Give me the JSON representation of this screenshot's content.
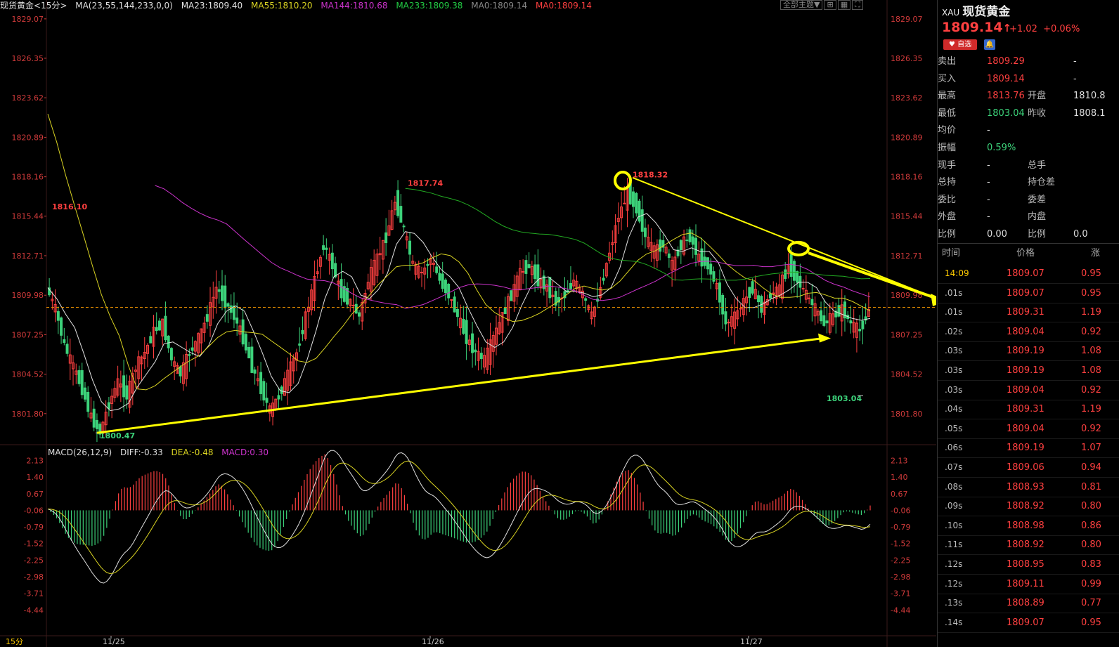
{
  "header": {
    "symbol_name": "现货黄金",
    "period": "<15分>",
    "ma_params": "MA(23,55,144,233,0,0)",
    "ma23": "MA23:1809.40",
    "ma55": "MA55:1810.20",
    "ma144": "MA144:1810.68",
    "ma233": "MA233:1809.38",
    "ma0a": "MA0:1809.14",
    "ma0b": "MA0:1809.14"
  },
  "toolbar": {
    "theme": "全部主题▼"
  },
  "macd_header": {
    "title": "MACD(26,12,9)",
    "diff": "DIFF:-0.33",
    "dea": "DEA:-0.48",
    "macd": "MACD:0.30"
  },
  "colors": {
    "up": "#ff4040",
    "down": "#3cd27a",
    "ma23": "#e0e0e0",
    "ma55": "#d9d322",
    "ma144": "#cc33cc",
    "ma233": "#22aa22",
    "annot": "#ffff00"
  },
  "price_axis": [
    "1829.07",
    "1826.35",
    "1823.62",
    "1820.89",
    "1818.16",
    "1815.44",
    "1812.71",
    "1809.98",
    "1807.25",
    "1804.52",
    "1801.80"
  ],
  "macd_axis": [
    "2.13",
    "1.40",
    "0.67",
    "-0.06",
    "-0.79",
    "-1.52",
    "-2.25",
    "-2.98",
    "-3.71",
    "-4.44"
  ],
  "labels": {
    "hi1": "1816.10",
    "hi2": "1817.74",
    "hi3": "1818.32",
    "lo1": "1800.47",
    "lo2": "1803.04"
  },
  "date_axis": [
    "11/25",
    "11/26",
    "11/27"
  ],
  "period_button": "15分",
  "panel": {
    "code": "XAU",
    "name": "现货黄金",
    "price": "1809.14",
    "arrow": "↑",
    "change": "+1.02",
    "change_pct": "+0.06%",
    "fav_label": "自选",
    "quotes": [
      {
        "l1": "卖出",
        "v1": "1809.29",
        "l2": "",
        "v2": "-"
      },
      {
        "l1": "买入",
        "v1": "1809.14",
        "l2": "",
        "v2": "-"
      },
      {
        "l1": "最高",
        "v1": "1813.76",
        "l2": "开盘",
        "v2": "1810.8"
      },
      {
        "l1": "最低",
        "v1": "1803.04",
        "l2": "昨收",
        "v2": "1808.1"
      },
      {
        "l1": "均价",
        "v1": "-",
        "l2": "",
        "v2": ""
      },
      {
        "l1": "振幅",
        "v1": "0.59%",
        "l2": "",
        "v2": ""
      },
      {
        "l1": "现手",
        "v1": "-",
        "l2": "总手",
        "v2": ""
      },
      {
        "l1": "总持",
        "v1": "-",
        "l2": "持仓差",
        "v2": ""
      },
      {
        "l1": "委比",
        "v1": "-",
        "l2": "委差",
        "v2": ""
      },
      {
        "l1": "外盘",
        "v1": "-",
        "l2": "内盘",
        "v2": ""
      },
      {
        "l1": "比例",
        "v1": "0.00",
        "l2": "比例",
        "v2": "0.0"
      }
    ],
    "ticks_header": {
      "time": "时间",
      "price": "价格",
      "chg": "涨"
    },
    "ticks": [
      {
        "t": "14:09",
        "p": "1809.07",
        "c": "0.95"
      },
      {
        "t": ".01s",
        "p": "1809.07",
        "c": "0.95"
      },
      {
        "t": ".01s",
        "p": "1809.31",
        "c": "1.19"
      },
      {
        "t": ".02s",
        "p": "1809.04",
        "c": "0.92"
      },
      {
        "t": ".03s",
        "p": "1809.19",
        "c": "1.08"
      },
      {
        "t": ".03s",
        "p": "1809.19",
        "c": "1.08"
      },
      {
        "t": ".03s",
        "p": "1809.04",
        "c": "0.92"
      },
      {
        "t": ".04s",
        "p": "1809.31",
        "c": "1.19"
      },
      {
        "t": ".05s",
        "p": "1809.04",
        "c": "0.92"
      },
      {
        "t": ".06s",
        "p": "1809.19",
        "c": "1.07"
      },
      {
        "t": ".07s",
        "p": "1809.06",
        "c": "0.94"
      },
      {
        "t": ".08s",
        "p": "1808.93",
        "c": "0.81"
      },
      {
        "t": ".09s",
        "p": "1808.92",
        "c": "0.80"
      },
      {
        "t": ".10s",
        "p": "1808.98",
        "c": "0.86"
      },
      {
        "t": ".11s",
        "p": "1808.92",
        "c": "0.80"
      },
      {
        "t": ".12s",
        "p": "1808.95",
        "c": "0.83"
      },
      {
        "t": ".12s",
        "p": "1809.11",
        "c": "0.99"
      },
      {
        "t": ".13s",
        "p": "1808.89",
        "c": "0.77"
      },
      {
        "t": ".14s",
        "p": "1809.07",
        "c": "0.95"
      }
    ]
  },
  "chart_data": {
    "type": "candlestick",
    "title": "现货黄金 <15分>",
    "ylim": [
      1800.0,
      1829.5
    ],
    "price_range_labels": {
      "high": 1818.32,
      "low": 1800.47,
      "last_low": 1803.04
    },
    "close_path": [
      1810.5,
      1809.0,
      1806.5,
      1805.0,
      1803.5,
      1801.5,
      1800.5,
      1802.5,
      1804.0,
      1803.0,
      1805.0,
      1806.0,
      1807.5,
      1808.0,
      1805.5,
      1804.5,
      1806.0,
      1807.0,
      1808.5,
      1810.5,
      1809.5,
      1808.5,
      1807.0,
      1805.0,
      1803.5,
      1802.0,
      1803.0,
      1804.5,
      1806.0,
      1808.5,
      1811.0,
      1813.5,
      1812.0,
      1810.0,
      1809.5,
      1808.5,
      1811.0,
      1812.5,
      1814.0,
      1816.5,
      1814.5,
      1812.0,
      1811.5,
      1812.5,
      1811.0,
      1810.0,
      1808.5,
      1807.0,
      1806.0,
      1805.5,
      1807.0,
      1808.5,
      1810.0,
      1811.5,
      1812.0,
      1811.0,
      1810.5,
      1809.5,
      1810.0,
      1811.0,
      1810.0,
      1808.5,
      1810.5,
      1813.0,
      1815.5,
      1817.0,
      1816.0,
      1814.0,
      1813.0,
      1813.5,
      1812.0,
      1813.5,
      1814.0,
      1812.5,
      1812.0,
      1810.5,
      1808.0,
      1808.5,
      1809.5,
      1810.5,
      1809.0,
      1810.0,
      1810.5,
      1812.0,
      1811.0,
      1810.0,
      1809.0,
      1808.0,
      1808.5,
      1809.0,
      1808.0,
      1807.5,
      1809.0
    ],
    "ma_series": [
      {
        "name": "MA23",
        "last": 1809.4
      },
      {
        "name": "MA55",
        "last": 1810.2
      },
      {
        "name": "MA144",
        "last": 1810.68
      },
      {
        "name": "MA233",
        "last": 1809.38
      }
    ],
    "macd": {
      "DIFF": -0.33,
      "DEA": -0.48,
      "MACD": 0.3,
      "ylim": [
        -4.8,
        2.3
      ]
    }
  }
}
